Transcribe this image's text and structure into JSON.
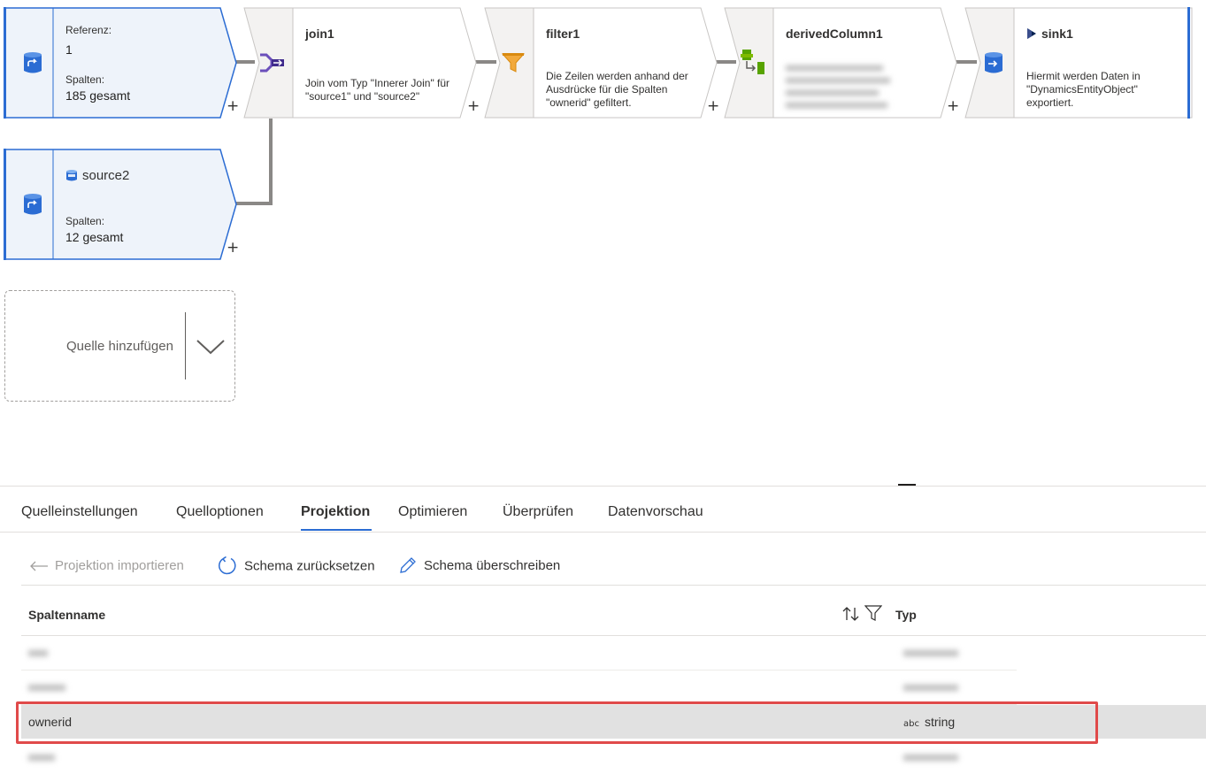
{
  "pipeline": {
    "source1": {
      "ref_label": "Referenz:",
      "ref_value": "1",
      "cols_label": "Spalten:",
      "cols_value": "185 gesamt"
    },
    "join": {
      "title": "join1",
      "desc": "Join vom Typ \"Innerer Join\" für \"source1\" und \"source2\""
    },
    "filter": {
      "title": "filter1",
      "desc": "Die Zeilen werden anhand der Ausdrücke für die Spalten \"ownerid\" gefiltert."
    },
    "derived": {
      "title": "derivedColumn1",
      "desc": ""
    },
    "sink": {
      "title": "sink1",
      "desc": "Hiermit werden Daten in \"DynamicsEntityObject\" exportiert."
    },
    "source2": {
      "title": "source2",
      "cols_label": "Spalten:",
      "cols_value": "12 gesamt"
    },
    "add_source": {
      "label": "Quelle hinzufügen"
    },
    "plus_symbol": "+"
  },
  "tabs": [
    "Quelleinstellungen",
    "Quelloptionen",
    "Projektion",
    "Optimieren",
    "Überprüfen",
    "Datenvorschau"
  ],
  "active_tab": "Projektion",
  "toolbar": {
    "import_label": "Projektion importieren",
    "reset_label": "Schema zurücksetzen",
    "override_label": "Schema überschreiben"
  },
  "table": {
    "col_name_header": "Spaltenname",
    "col_type_header": "Typ",
    "rows": [
      {
        "name": "",
        "type_tag": "",
        "type": "",
        "blurred": true,
        "selected": false
      },
      {
        "name": "",
        "type_tag": "",
        "type": "",
        "blurred": true,
        "selected": false
      },
      {
        "name": "ownerid",
        "type_tag": "abc",
        "type": "string",
        "blurred": false,
        "selected": true
      },
      {
        "name": "",
        "type_tag": "",
        "type": "",
        "blurred": true,
        "selected": false
      }
    ]
  },
  "colors": {
    "accent": "#2b6cd3",
    "node_fill": "#eef3fa",
    "node_grey": "#f3f2f1",
    "selection_outline": "#e04a4a",
    "selected_row": "#e1e1e1"
  }
}
